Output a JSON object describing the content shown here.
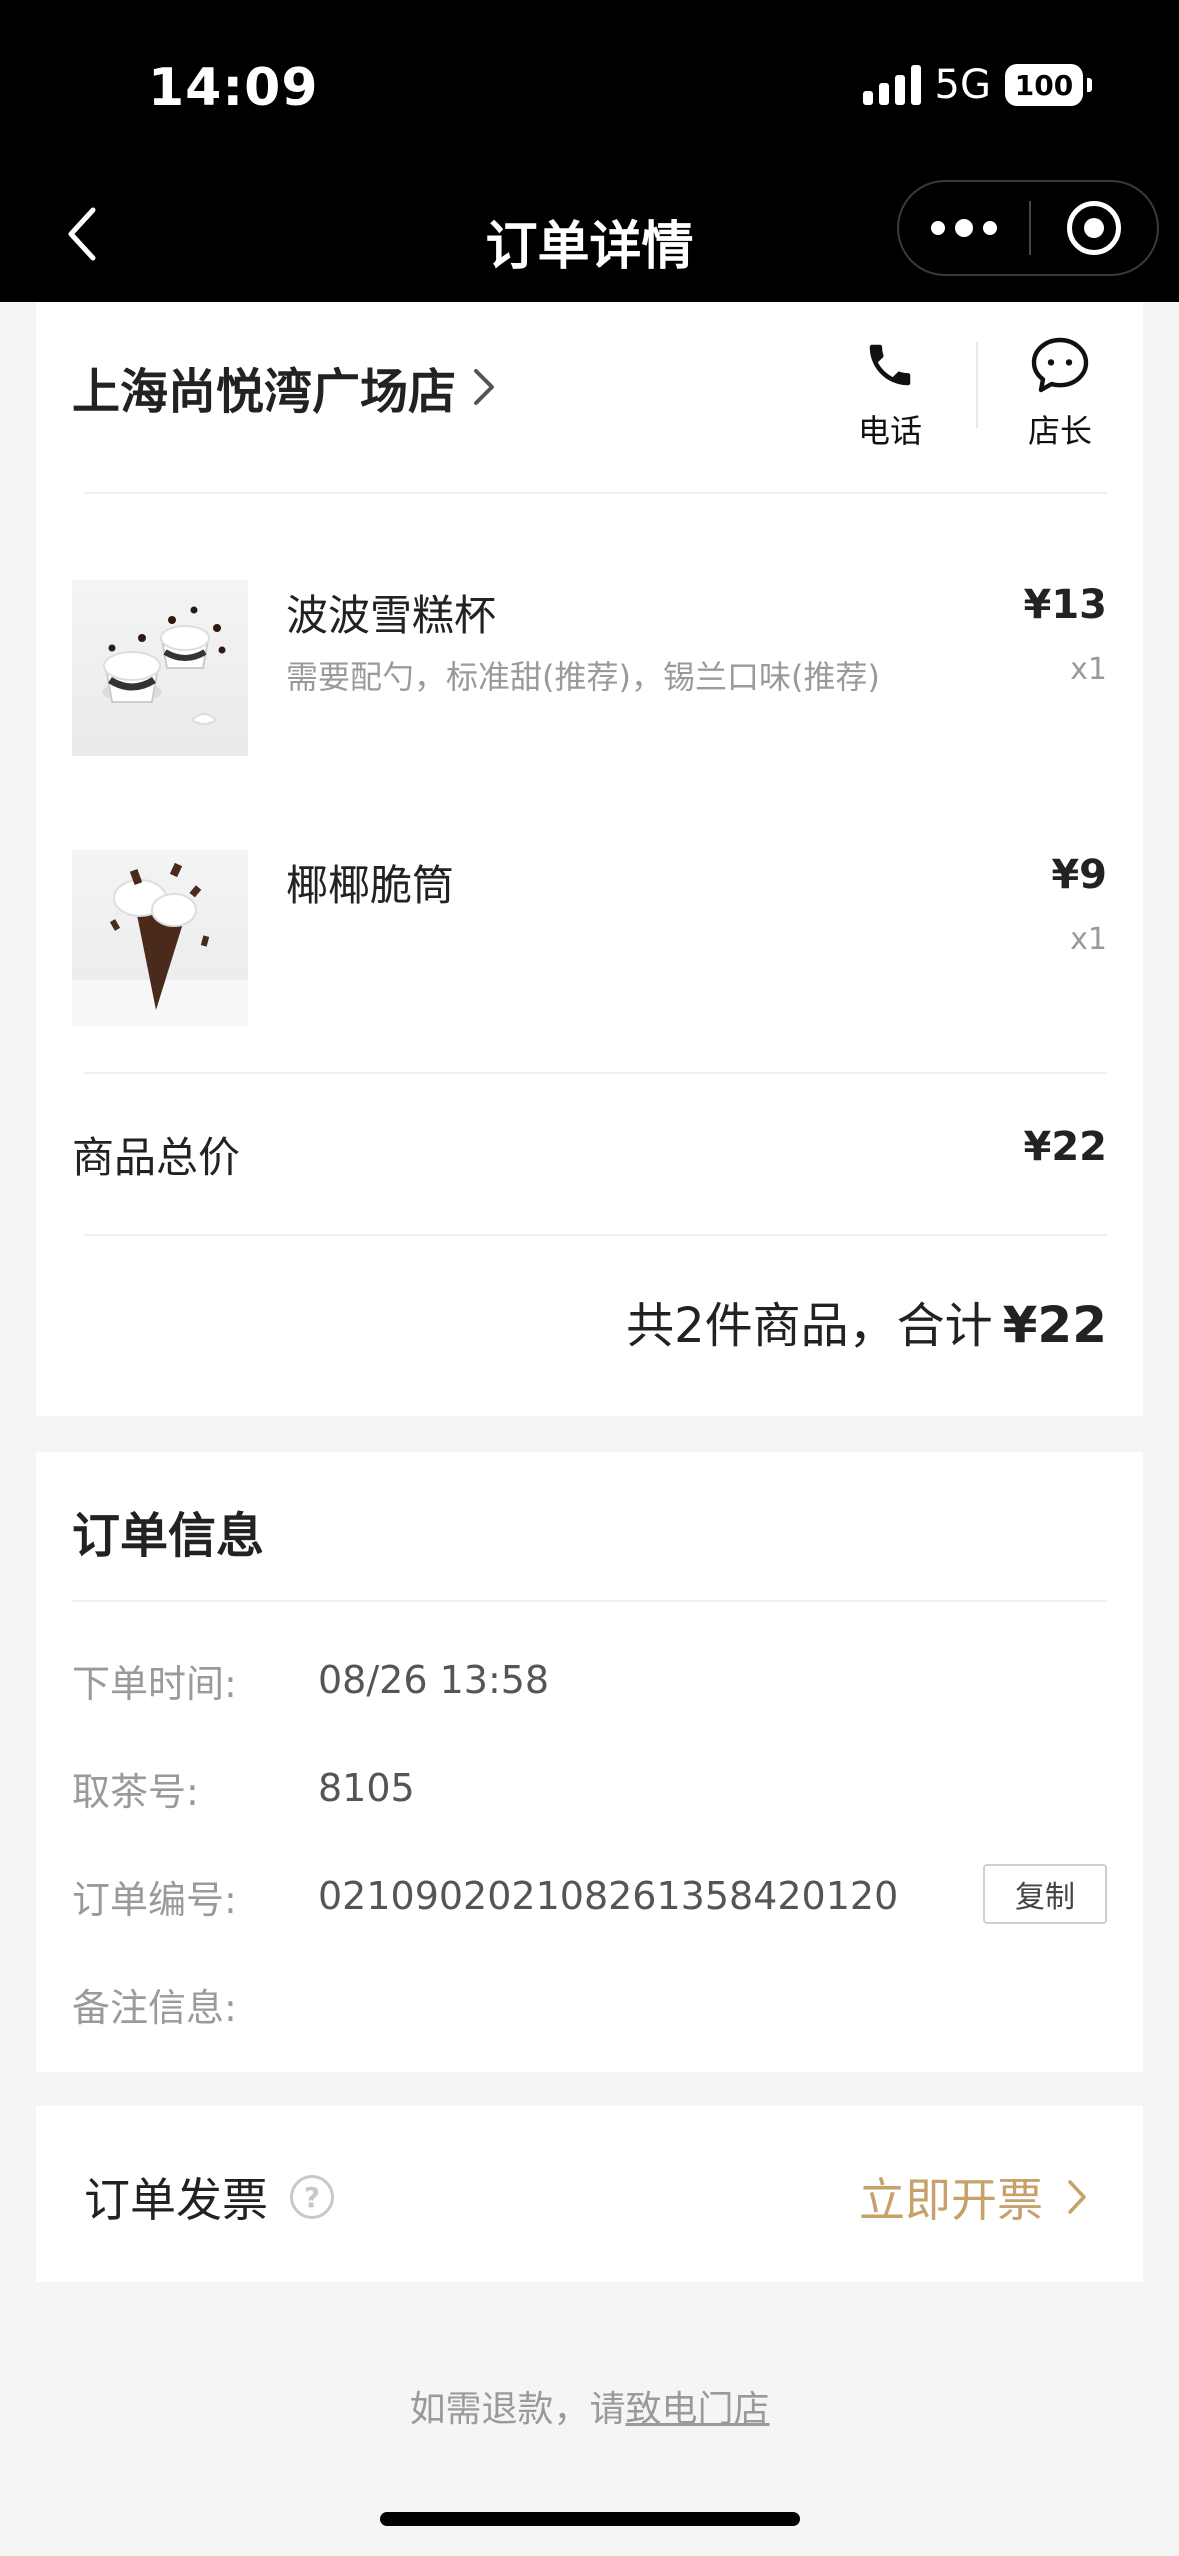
{
  "status_bar": {
    "time": "14:09",
    "network": "5G",
    "battery": "100"
  },
  "nav": {
    "title": "订单详情"
  },
  "store": {
    "name": "上海尚悦湾广场店",
    "phone_label": "电话",
    "manager_label": "店长"
  },
  "items": [
    {
      "name": "波波雪糕杯",
      "spec": "需要配勺，标准甜(推荐)，锡兰口味(推荐)",
      "price": "¥13",
      "qty": "x1"
    },
    {
      "name": "椰椰脆筒",
      "spec": "",
      "price": "¥9",
      "qty": "x1"
    }
  ],
  "summary": {
    "subtotal_label": "商品总价",
    "subtotal_value": "¥22",
    "total_prefix": "共2件商品，合计",
    "total_amount": "¥22"
  },
  "order_info": {
    "title": "订单信息",
    "rows": [
      {
        "label": "下单时间:",
        "value": "08/26 13:58"
      },
      {
        "label": "取茶号:",
        "value": "8105"
      },
      {
        "label": "订单编号:",
        "value": "021090202108261358420120"
      },
      {
        "label": "备注信息:",
        "value": ""
      }
    ],
    "copy_label": "复制"
  },
  "invoice": {
    "label": "订单发票",
    "help_icon_text": "?",
    "action_label": "立即开票",
    "action_color": "#c8a06a"
  },
  "footer": {
    "note_prefix": "如需退款，请",
    "note_link": "致电门店"
  }
}
